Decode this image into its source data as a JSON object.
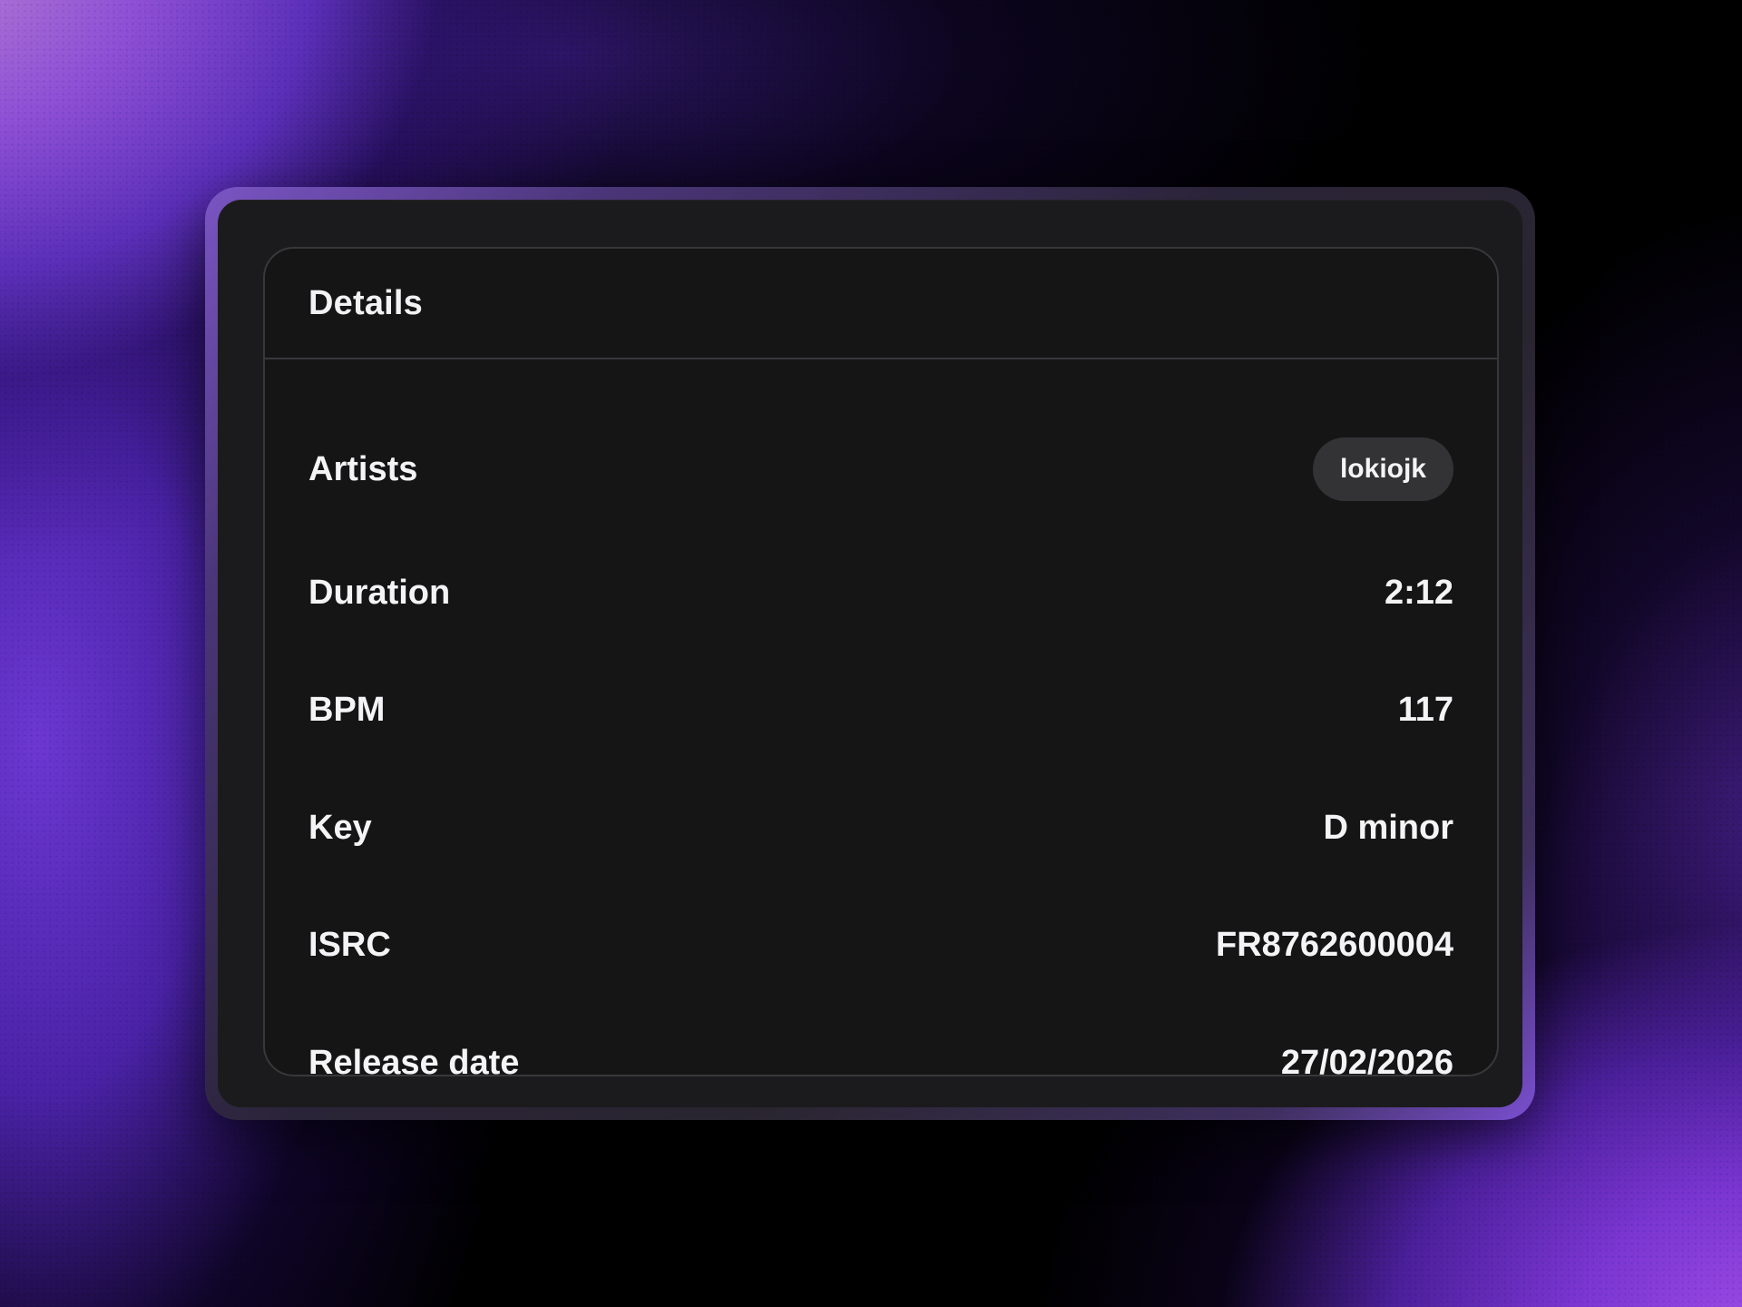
{
  "details": {
    "title": "Details",
    "rows": [
      {
        "label": "Artists",
        "value": "lokiojk"
      },
      {
        "label": "Duration",
        "value": "2:12"
      },
      {
        "label": "BPM",
        "value": "117"
      },
      {
        "label": "Key",
        "value": "D minor"
      },
      {
        "label": "ISRC",
        "value": "FR8762600004"
      },
      {
        "label": "Release date",
        "value": "27/02/2026"
      }
    ]
  }
}
